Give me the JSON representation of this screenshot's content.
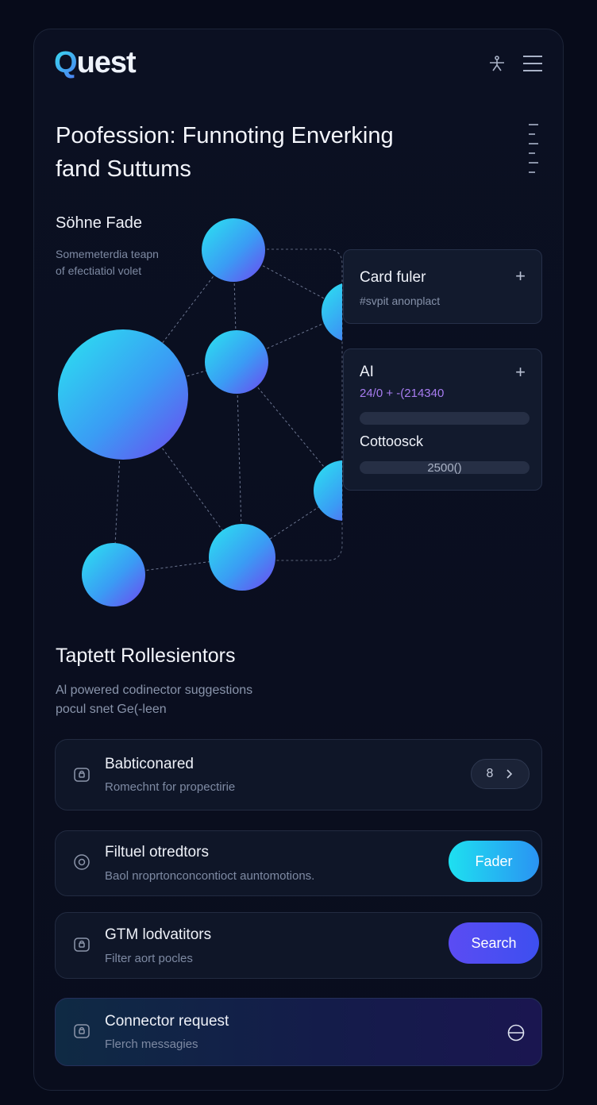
{
  "app": {
    "logo_first": "Q",
    "logo_rest": "uest"
  },
  "header": {
    "icons": [
      "accessibility-icon",
      "menu-icon"
    ]
  },
  "hero": {
    "headline_line1": "Poofession: Funnoting Enverking",
    "headline_line2": "fand Suttums"
  },
  "graph_section": {
    "title": "Söhne Fade",
    "desc_line1": "Somemeterdia teapn",
    "desc_line2": "of efectiatiol volet"
  },
  "card_filter": {
    "title": "Card fuler",
    "subtitle": "#svpit anonplact",
    "action": "+"
  },
  "card_ai": {
    "title": "AI",
    "value": "24/0 + -(214340",
    "action": "+",
    "label2": "Cottoosck",
    "bar2_value": "2500()",
    "value_color": "#a77cf0"
  },
  "suggestions": {
    "title": "Taptett Rollesientors",
    "desc_line1": "Al powered codinector suggestions",
    "desc_line2": "pocul snet Ge(-leen",
    "items": [
      {
        "title": "Babticonared",
        "desc": "Romechnt for propectirie",
        "icon": "lock-icon",
        "action_label": "8",
        "action_icon": "chevron-right-icon"
      },
      {
        "title": "Filtuel otredtors",
        "desc": "Baol nroprtonconcontioct auntomotions.",
        "icon": "info-icon",
        "action_label": "Fader"
      },
      {
        "title": "GTM lodvatitors",
        "desc": "Filter aort pocles",
        "icon": "lock-icon",
        "action_label": "Search"
      },
      {
        "title": "Connector request",
        "desc": "Flerch messagies",
        "icon": "lock-icon",
        "action_icon": "minus-circle-icon"
      }
    ]
  },
  "colors": {
    "background": "#070b1a",
    "accent_cyan": "#27d3f2",
    "accent_violet": "#6a4cf5",
    "node_gradient_start": "#2be4f0",
    "node_gradient_end": "#6e48f0"
  }
}
